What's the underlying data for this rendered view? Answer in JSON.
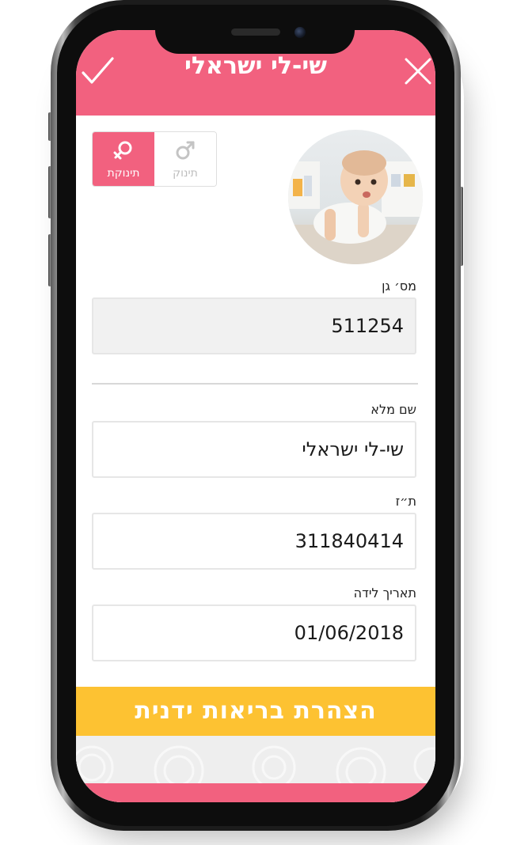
{
  "header": {
    "title": "שי-לי ישראלי",
    "confirm_icon": "checkmark-icon",
    "close_icon": "close-icon"
  },
  "profile": {
    "avatar_alt": "baby-photo"
  },
  "gender": {
    "female_label": "תינוקת",
    "male_label": "תינוק",
    "selected": "female",
    "female_icon": "female-symbol-icon",
    "male_icon": "male-symbol-icon"
  },
  "fields": {
    "kindergarten": {
      "label": "מס׳ גן",
      "value": "511254"
    },
    "full_name": {
      "label": "שם מלא",
      "value": "שי-לי ישראלי"
    },
    "id_number": {
      "label": "ת״ז",
      "value": "311840414"
    },
    "birth_date": {
      "label": "תאריך לידה",
      "value": "01/06/2018"
    }
  },
  "cta": {
    "label": "הצהרת בריאות ידנית"
  },
  "colors": {
    "brand_pink": "#f2617f",
    "cta_yellow": "#fdc232",
    "field_border": "#e6e6e6",
    "readonly_bg": "#f1f1f1"
  }
}
